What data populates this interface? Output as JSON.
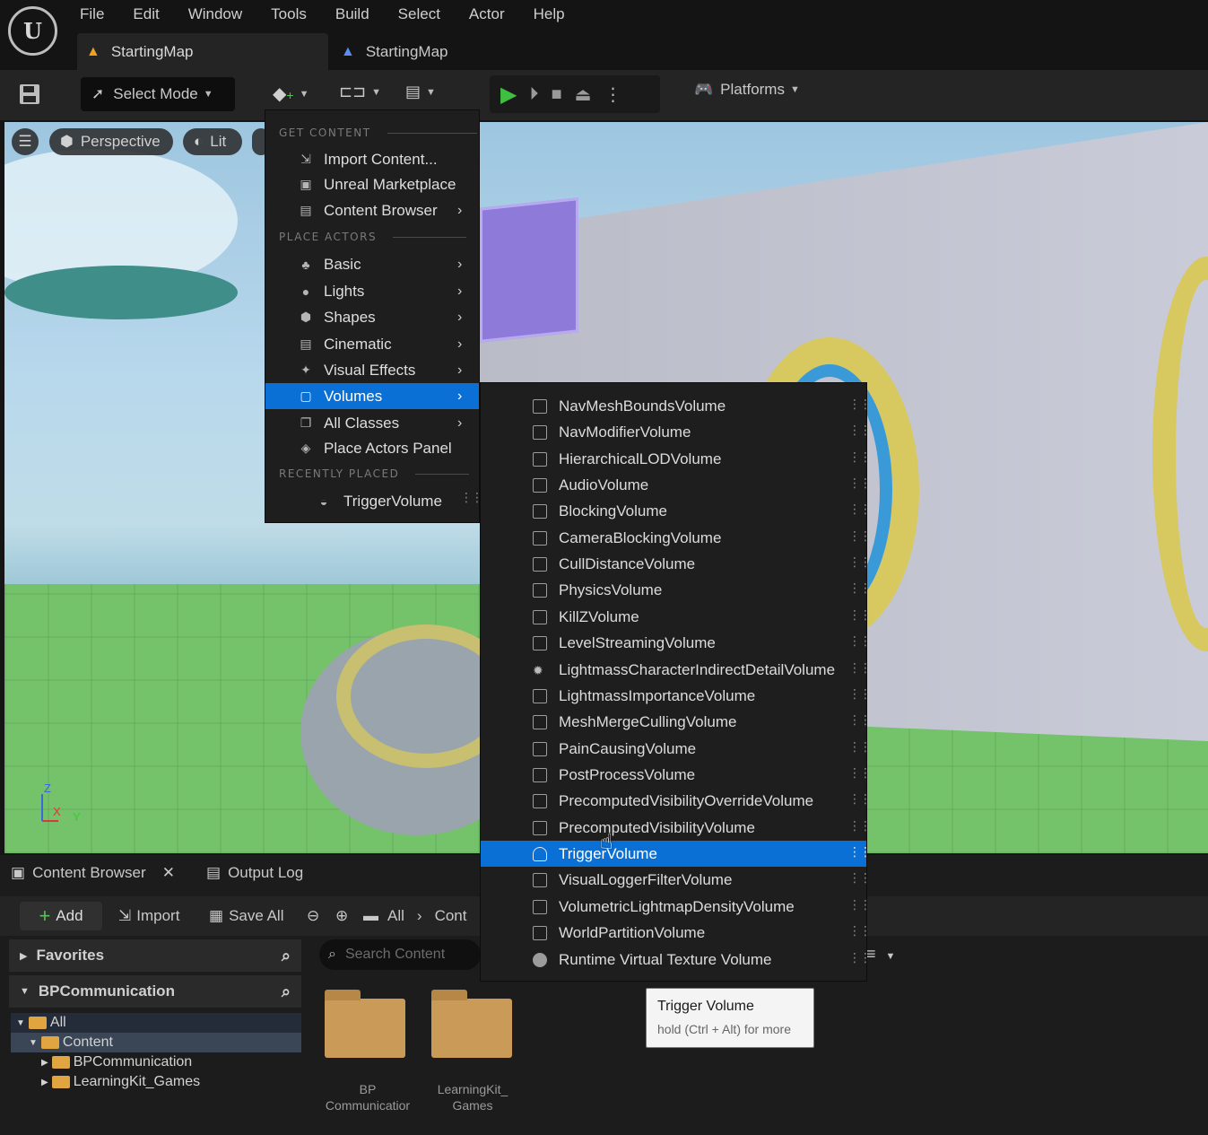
{
  "menubar": {
    "logo": "U",
    "items": [
      {
        "label": "File"
      },
      {
        "label": "Edit"
      },
      {
        "label": "Window"
      },
      {
        "label": "Tools"
      },
      {
        "label": "Build"
      },
      {
        "label": "Select"
      },
      {
        "label": "Actor"
      },
      {
        "label": "Help"
      }
    ]
  },
  "tabs": {
    "active": {
      "label": "StartingMap",
      "icon": "map-icon"
    },
    "inactive": {
      "label": "StartingMap",
      "icon": "blueprint-map-icon"
    }
  },
  "toolbar": {
    "select_mode": "Select Mode",
    "platforms": "Platforms",
    "play_color": "#3fbf3f"
  },
  "viewport": {
    "perspective": "Perspective",
    "lit": "Lit",
    "axis_z": "Z",
    "axis_x": "X",
    "axis_y": "Y"
  },
  "add_menu": {
    "get_content_label": "GET CONTENT",
    "place_actors_label": "PLACE ACTORS",
    "recently_placed_label": "RECENTLY PLACED",
    "get_content": [
      {
        "label": "Import Content..."
      },
      {
        "label": "Unreal Marketplace"
      },
      {
        "label": "Content Browser",
        "submenu": true
      }
    ],
    "place_actors": [
      {
        "label": "Basic",
        "submenu": true
      },
      {
        "label": "Lights",
        "submenu": true
      },
      {
        "label": "Shapes",
        "submenu": true
      },
      {
        "label": "Cinematic",
        "submenu": true
      },
      {
        "label": "Visual Effects",
        "submenu": true
      },
      {
        "label": "Volumes",
        "submenu": true,
        "highlighted": true
      },
      {
        "label": "All Classes",
        "submenu": true
      },
      {
        "label": "Place Actors Panel"
      }
    ],
    "recently_placed": [
      {
        "label": "TriggerVolume"
      }
    ],
    "highlight_color": "#0a70d6"
  },
  "volumes_menu": {
    "items": [
      {
        "label": "NavMeshBoundsVolume"
      },
      {
        "label": "NavModifierVolume"
      },
      {
        "label": "HierarchicalLODVolume"
      },
      {
        "label": "AudioVolume"
      },
      {
        "label": "BlockingVolume"
      },
      {
        "label": "CameraBlockingVolume"
      },
      {
        "label": "CullDistanceVolume"
      },
      {
        "label": "PhysicsVolume"
      },
      {
        "label": "KillZVolume"
      },
      {
        "label": "LevelStreamingVolume"
      },
      {
        "label": "LightmassCharacterIndirectDetailVolume"
      },
      {
        "label": "LightmassImportanceVolume"
      },
      {
        "label": "MeshMergeCullingVolume"
      },
      {
        "label": "PainCausingVolume"
      },
      {
        "label": "PostProcessVolume"
      },
      {
        "label": "PrecomputedVisibilityOverrideVolume"
      },
      {
        "label": "PrecomputedVisibilityVolume"
      },
      {
        "label": "TriggerVolume",
        "highlighted": true
      },
      {
        "label": "VisualLoggerFilterVolume"
      },
      {
        "label": "VolumetricLightmapDensityVolume"
      },
      {
        "label": "WorldPartitionVolume"
      },
      {
        "label": "Runtime Virtual Texture Volume"
      }
    ]
  },
  "tooltip": {
    "title": "Trigger Volume",
    "hint": "hold (Ctrl + Alt) for more"
  },
  "bottom_panel": {
    "tabs": [
      {
        "label": "Content Browser"
      },
      {
        "label": "Output Log"
      }
    ],
    "toolbar": {
      "add": "Add",
      "import": "Import",
      "save_all": "Save All",
      "path_all": "All",
      "path_content": "Cont"
    },
    "favorites": "Favorites",
    "project": "BPCommunication",
    "search_placeholder": "Search Content",
    "tree": [
      {
        "label": "All"
      },
      {
        "label": "Content"
      },
      {
        "label": "BPCommunication"
      },
      {
        "label": "LearningKit_Games"
      }
    ],
    "folders": [
      {
        "line1": "BP",
        "line2": "Communicatior"
      },
      {
        "line1": "LearningKit_",
        "line2": "Games"
      }
    ]
  }
}
